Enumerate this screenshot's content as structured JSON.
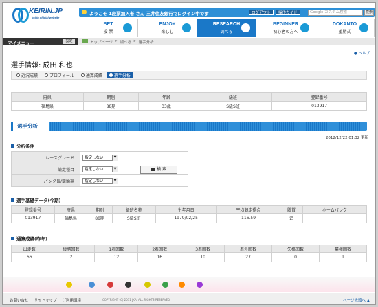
{
  "logo": {
    "text": "KEIRIN.JP",
    "tagline": "keirin official website"
  },
  "header": {
    "welcome": "ようこそ 1段票加入者 さん 三井住友銀行でログイン中です",
    "logout": "ログアウト",
    "guide": "操作ガイド",
    "search_placeholder": "Google カスタム検索",
    "search_button": "検索"
  },
  "nav": [
    {
      "en": "BET",
      "jp": "投 票"
    },
    {
      "en": "ENJOY",
      "jp": "楽しむ"
    },
    {
      "en": "RESEARCH",
      "jp": "調べる"
    },
    {
      "en": "BEGINNER",
      "jp": "初心者の方へ"
    },
    {
      "en": "DOKANTO",
      "jp": "重勝式"
    }
  ],
  "mymenu": {
    "label": "マイメニュー",
    "button": "設定"
  },
  "breadcrumb": [
    "トップページ",
    "調べる",
    "選手分析"
  ],
  "help": "ヘルプ",
  "title": "選手情報: 成田 和也",
  "subtabs": [
    "近況成績",
    "プロフィール",
    "通算成績",
    "選手分析"
  ],
  "profile": {
    "headers": [
      "府県",
      "期別",
      "年齢",
      "級班",
      "登録番号"
    ],
    "values": [
      "福島県",
      "88期",
      "33歳",
      "S級S班",
      "013917"
    ]
  },
  "section": "選手分析",
  "updated": "2012/12/22 01:32 更新",
  "conditions": {
    "heading": "分析条件",
    "rows": [
      {
        "label": "レースグレード",
        "value": "指定しない"
      },
      {
        "label": "競走種目",
        "value": "指定しない"
      },
      {
        "label": "バンク長/競輪場",
        "value": "指定しない"
      }
    ],
    "search": "検 索"
  },
  "basic": {
    "heading": "選手基礎データ(今期)",
    "headers": [
      "登録番号",
      "府県",
      "期別",
      "級班名称",
      "生年月日",
      "平均競走得点",
      "脚質",
      "ホームバンク"
    ],
    "values": [
      "013917",
      "福島県",
      "88期",
      "S級S班",
      "1979/02/25",
      "116.59",
      "追",
      "-"
    ]
  },
  "record": {
    "heading": "通算成績(昨年)",
    "headers": [
      "出走数",
      "優勝回数",
      "1着回数",
      "2着回数",
      "3着回数",
      "着外回数",
      "失格回数",
      "棄権回数"
    ],
    "values": [
      "66",
      "2",
      "12",
      "16",
      "10",
      "27",
      "0",
      "1"
    ]
  },
  "footer": {
    "links": [
      "お問い合せ",
      "サイトマップ",
      "ご利用環境"
    ],
    "copyright": "COPYRIGHT (C) 2011 JKA. ALL RIGHTS RESERVED.",
    "totop": "ページ先頭へ"
  },
  "colors": {
    "accent": "#1a78c8",
    "dark": "#1a5fa8"
  }
}
